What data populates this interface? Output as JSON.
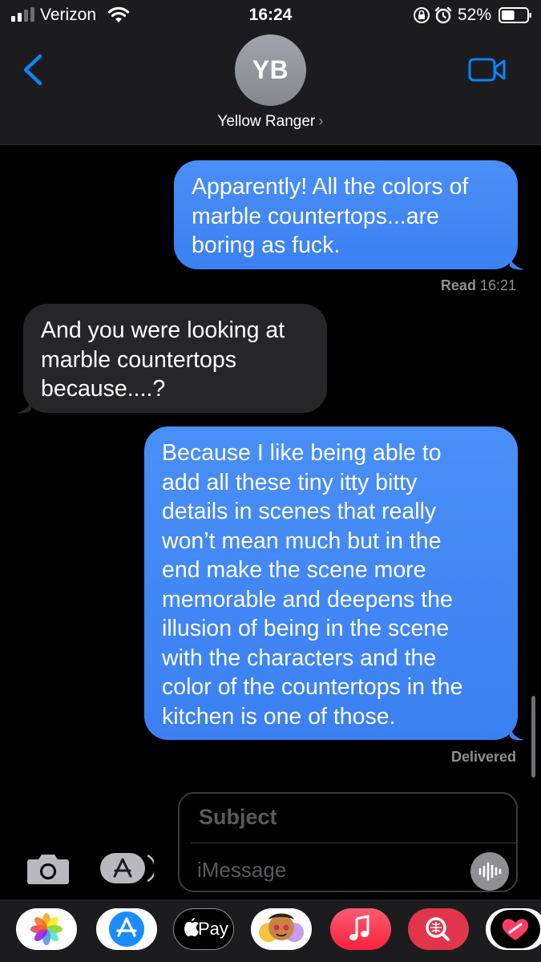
{
  "status_bar": {
    "carrier": "Verizon",
    "time": "16:24",
    "battery_percent": "52%",
    "battery_level": 0.52
  },
  "header": {
    "avatar_initials": "YB",
    "contact_name": "Yellow Ranger",
    "contact_chevron": "›",
    "icons": [
      "back-chevron-icon",
      "facetime-video-icon"
    ]
  },
  "messages": [
    {
      "direction": "sent",
      "lines": [
        "Apparently! All the colors of",
        "marble countertops...are",
        "boring as fuck."
      ],
      "status_label": "Read",
      "status_time": "16:21"
    },
    {
      "direction": "received",
      "lines": [
        "And you were looking at",
        "marble countertops",
        "because....?"
      ]
    },
    {
      "direction": "sent",
      "lines": [
        "Because I like being able to",
        "add all these tiny itty bitty",
        "details in scenes that really",
        "won’t mean much but in the",
        "end make the scene more",
        "memorable and deepens the",
        "illusion of being in the scene",
        "with the characters and the",
        "color of the countertops in the",
        "kitchen is one of those."
      ],
      "status_label": "Delivered"
    }
  ],
  "composer": {
    "subject_placeholder": "Subject",
    "message_placeholder": "iMessage",
    "icons": [
      "camera-icon",
      "app-store-icon",
      "audio-message-icon"
    ]
  },
  "app_drawer": {
    "apple_pay_label": "Pay",
    "apps": [
      "photos-icon",
      "app-store-icon",
      "apple-pay-icon",
      "memoji-icon",
      "music-icon",
      "search-images-icon",
      "digital-touch-icon"
    ]
  },
  "colors": {
    "sent_bubble": "#3b82f6",
    "received_bubble": "#262629",
    "accent": "#0a84ff",
    "header_bg": "#1c1c1e"
  }
}
